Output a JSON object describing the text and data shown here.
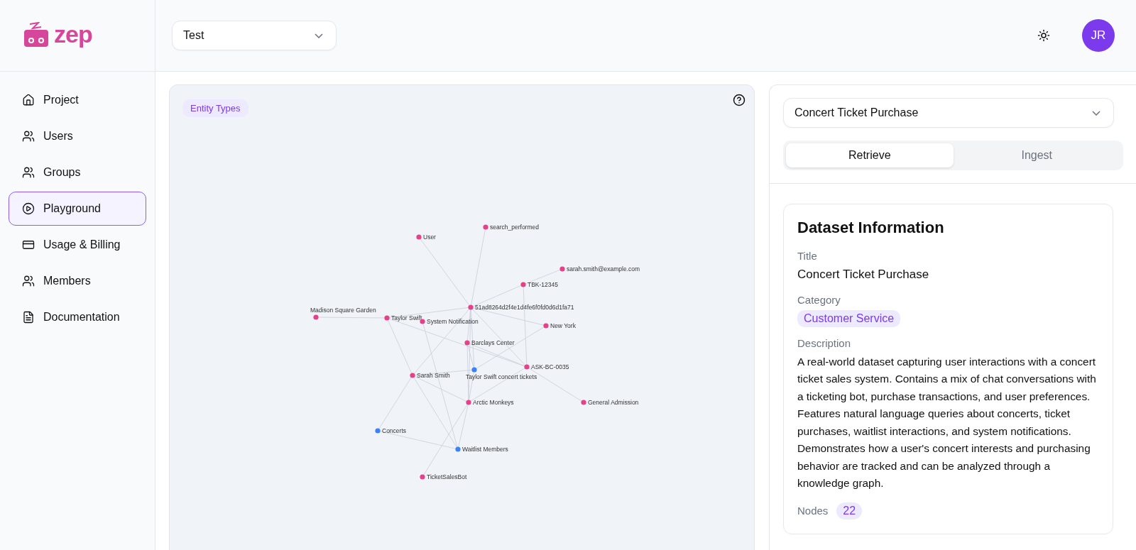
{
  "logo": {
    "text": "zep"
  },
  "project_select": {
    "value": "Test"
  },
  "avatar": {
    "initials": "JR"
  },
  "nav": [
    {
      "label": "Project",
      "selected": false
    },
    {
      "label": "Users",
      "selected": false
    },
    {
      "label": "Groups",
      "selected": false
    },
    {
      "label": "Playground",
      "selected": true
    },
    {
      "label": "Usage & Billing",
      "selected": false
    },
    {
      "label": "Members",
      "selected": false
    },
    {
      "label": "Documentation",
      "selected": false
    }
  ],
  "graph": {
    "badge": "Entity Types",
    "nodes": [
      {
        "label": "User",
        "color": "#e5408a"
      },
      {
        "label": "search_performed",
        "color": "#e5408a"
      },
      {
        "label": "sarah.smith@example.com",
        "color": "#e5408a"
      },
      {
        "label": "TBK-12345",
        "color": "#e5408a"
      },
      {
        "label": "51ad8264d2f4e1d4fe6f0fd0d6d1fa71",
        "color": "#e5408a"
      },
      {
        "label": "New York",
        "color": "#e5408a"
      },
      {
        "label": "Madison Square Garden",
        "color": "#e5408a"
      },
      {
        "label": "Taylor Swift",
        "color": "#e5408a"
      },
      {
        "label": "System Notification",
        "color": "#e5408a"
      },
      {
        "label": "Barclays Center",
        "color": "#e5408a"
      },
      {
        "label": "Taylor Swift concert tickets",
        "color": "#3b82f6"
      },
      {
        "label": "ASK-BC-0035",
        "color": "#e5408a"
      },
      {
        "label": "Sarah Smith",
        "color": "#e5408a"
      },
      {
        "label": "Arctic Monkeys",
        "color": "#e5408a"
      },
      {
        "label": "General Admission",
        "color": "#e5408a"
      },
      {
        "label": "Concerts",
        "color": "#3b82f6"
      },
      {
        "label": "Waitlist Members",
        "color": "#3b82f6"
      },
      {
        "label": "TicketSalesBot",
        "color": "#e5408a"
      }
    ]
  },
  "dataset_select": {
    "value": "Concert Ticket Purchase"
  },
  "tabs": [
    {
      "label": "Retrieve",
      "selected": true
    },
    {
      "label": "Ingest",
      "selected": false
    }
  ],
  "dataset": {
    "heading": "Dataset Information",
    "fields": [
      {
        "label": "Title",
        "value": "Concert Ticket Purchase",
        "kind": "text"
      },
      {
        "label": "Category",
        "value": "Customer Service",
        "kind": "badge"
      },
      {
        "label": "Description",
        "value": "A real-world dataset capturing user interactions with a concert ticket sales system. Contains a mix of chat conversations with a ticketing bot, purchase transactions, and user preferences. Features natural language queries about concerts, ticket purchases, waitlist interactions, and system notifications. Demonstrates how a user's concert interests and purchasing behavior are tracked and can be analyzed through a knowledge graph.",
        "kind": "text"
      }
    ],
    "nodes_count": {
      "label": "Nodes",
      "value": "22"
    }
  }
}
